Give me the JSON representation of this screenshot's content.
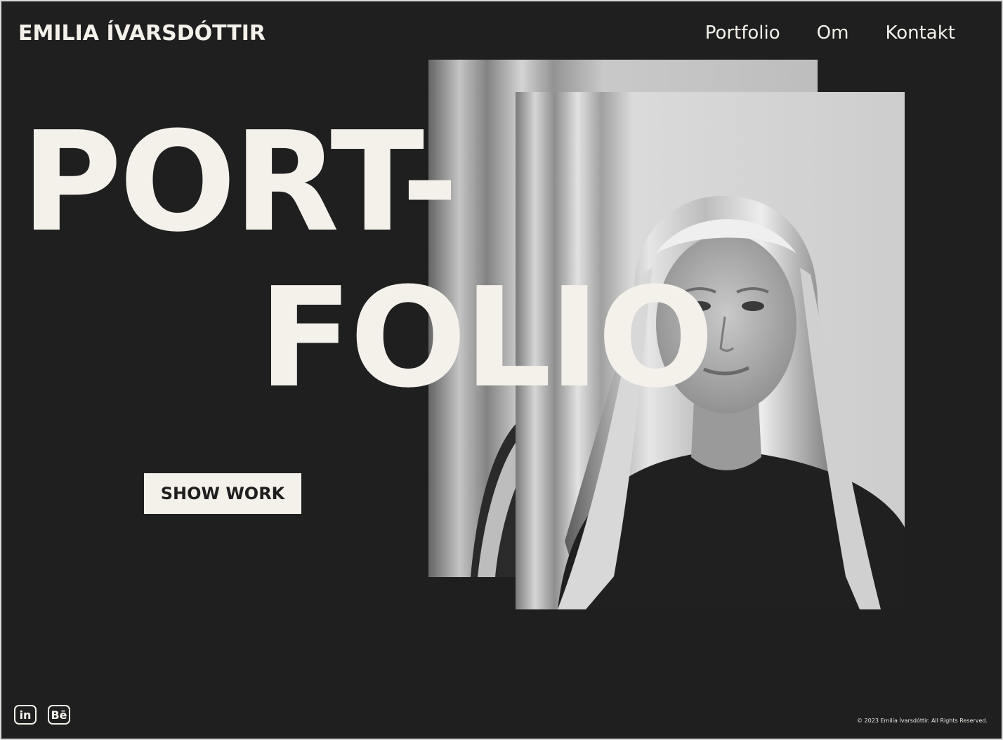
{
  "header": {
    "brand": "EMILIA ÍVARSDÓTTIR",
    "nav": [
      "Portfolio",
      "Om",
      "Kontakt"
    ]
  },
  "hero": {
    "line1": "PORT-",
    "line2": "FOLIO",
    "cta_label": "SHOW WORK"
  },
  "photos": {
    "description_icon": "portrait-photo"
  },
  "footer": {
    "social": [
      {
        "icon": "linkedin-icon",
        "glyph": "in"
      },
      {
        "icon": "behance-icon",
        "glyph": "Bē"
      }
    ],
    "copyright": "© 2023 Emilía Ívarsdóttir. All Rights Reserved."
  },
  "colors": {
    "background": "#1f1f1f",
    "text": "#f3f1ea"
  }
}
